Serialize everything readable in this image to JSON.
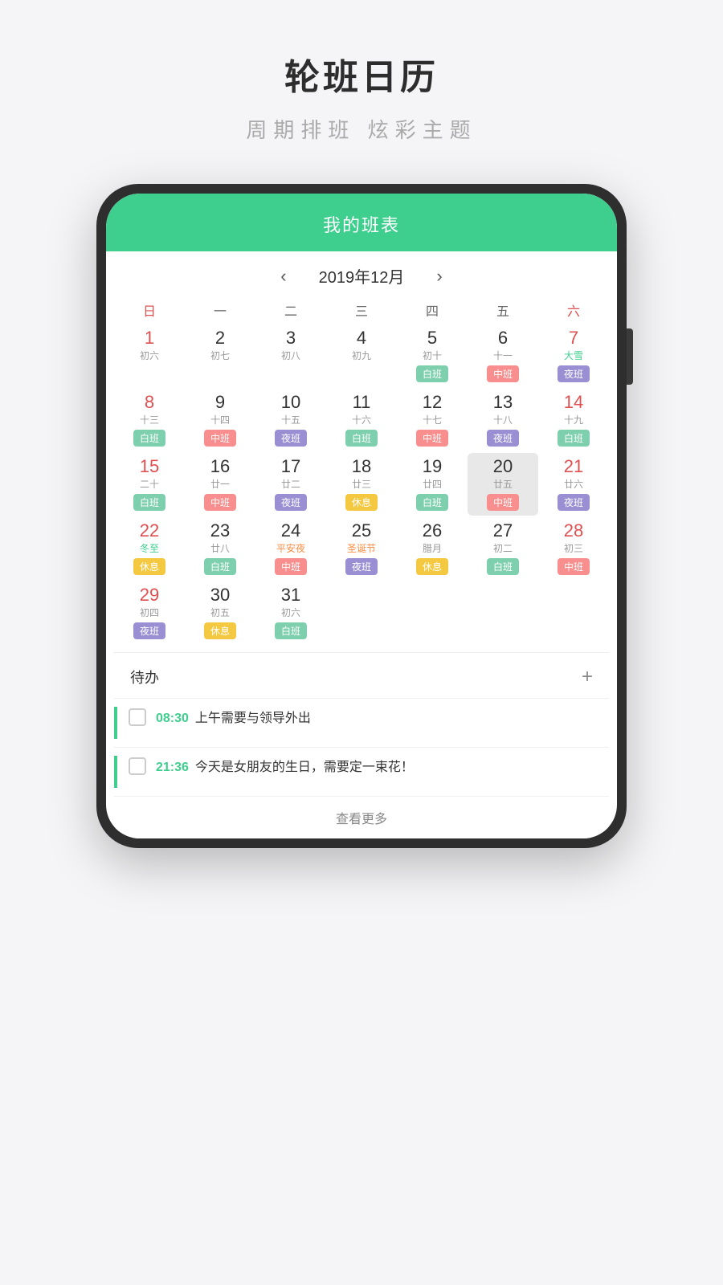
{
  "app": {
    "title": "轮班日历",
    "subtitle": "周期排班  炫彩主题"
  },
  "calendar": {
    "header": "我的班表",
    "month_label": "2019年12月",
    "prev_btn": "‹",
    "next_btn": "›",
    "week_days": [
      "日",
      "一",
      "二",
      "三",
      "四",
      "五",
      "六"
    ],
    "weeks": [
      [
        {
          "day": "1",
          "lunar": "初六",
          "shift": "",
          "shift_type": "",
          "red": true
        },
        {
          "day": "2",
          "lunar": "初七",
          "shift": "",
          "shift_type": ""
        },
        {
          "day": "3",
          "lunar": "初八",
          "shift": "",
          "shift_type": ""
        },
        {
          "day": "4",
          "lunar": "初九",
          "shift": "",
          "shift_type": ""
        },
        {
          "day": "5",
          "lunar": "初十",
          "shift": "白班",
          "shift_type": "white"
        },
        {
          "day": "6",
          "lunar": "十一",
          "shift": "中班",
          "shift_type": "mid"
        },
        {
          "day": "7",
          "lunar": "大雪",
          "shift": "夜班",
          "shift_type": "night",
          "red": true,
          "festival": "solar-term"
        }
      ],
      [
        {
          "day": "8",
          "lunar": "十三",
          "shift": "白班",
          "shift_type": "white",
          "red": true
        },
        {
          "day": "9",
          "lunar": "十四",
          "shift": "中班",
          "shift_type": "mid"
        },
        {
          "day": "10",
          "lunar": "十五",
          "shift": "夜班",
          "shift_type": "night"
        },
        {
          "day": "11",
          "lunar": "十六",
          "shift": "白班",
          "shift_type": "white"
        },
        {
          "day": "12",
          "lunar": "十七",
          "shift": "中班",
          "shift_type": "mid"
        },
        {
          "day": "13",
          "lunar": "十八",
          "shift": "夜班",
          "shift_type": "night"
        },
        {
          "day": "14",
          "lunar": "十九",
          "shift": "白班",
          "shift_type": "white",
          "red": true
        }
      ],
      [
        {
          "day": "15",
          "lunar": "二十",
          "shift": "白班",
          "shift_type": "white",
          "red": true
        },
        {
          "day": "16",
          "lunar": "廿一",
          "shift": "中班",
          "shift_type": "mid"
        },
        {
          "day": "17",
          "lunar": "廿二",
          "shift": "夜班",
          "shift_type": "night"
        },
        {
          "day": "18",
          "lunar": "廿三",
          "shift": "休息",
          "shift_type": "rest"
        },
        {
          "day": "19",
          "lunar": "廿四",
          "shift": "白班",
          "shift_type": "white"
        },
        {
          "day": "20",
          "lunar": "廿五",
          "shift": "中班",
          "shift_type": "mid",
          "highlighted": true
        },
        {
          "day": "21",
          "lunar": "廿六",
          "shift": "夜班",
          "shift_type": "night",
          "red": true
        }
      ],
      [
        {
          "day": "22",
          "lunar": "冬至",
          "shift": "休息",
          "shift_type": "rest",
          "red": true,
          "festival": "solar-term"
        },
        {
          "day": "23",
          "lunar": "廿八",
          "shift": "白班",
          "shift_type": "white"
        },
        {
          "day": "24",
          "lunar": "平安夜",
          "shift": "中班",
          "shift_type": "mid",
          "festival": "festival"
        },
        {
          "day": "25",
          "lunar": "圣诞节",
          "shift": "夜班",
          "shift_type": "night",
          "festival": "festival"
        },
        {
          "day": "26",
          "lunar": "腊月",
          "shift": "休息",
          "shift_type": "rest"
        },
        {
          "day": "27",
          "lunar": "初二",
          "shift": "白班",
          "shift_type": "white"
        },
        {
          "day": "28",
          "lunar": "初三",
          "shift": "中班",
          "shift_type": "mid",
          "red": true
        }
      ],
      [
        {
          "day": "29",
          "lunar": "初四",
          "shift": "夜班",
          "shift_type": "night",
          "red": true
        },
        {
          "day": "30",
          "lunar": "初五",
          "shift": "休息",
          "shift_type": "rest"
        },
        {
          "day": "31",
          "lunar": "初六",
          "shift": "白班",
          "shift_type": "white"
        },
        null,
        null,
        null,
        null
      ]
    ]
  },
  "todo": {
    "header": "待办",
    "add_btn": "+",
    "items": [
      {
        "time": "08:30",
        "text": "上午需要与领导外出"
      },
      {
        "time": "21:36",
        "text": "今天是女朋友的生日，需要定一束花！"
      }
    ],
    "more_label": "查看更多"
  }
}
